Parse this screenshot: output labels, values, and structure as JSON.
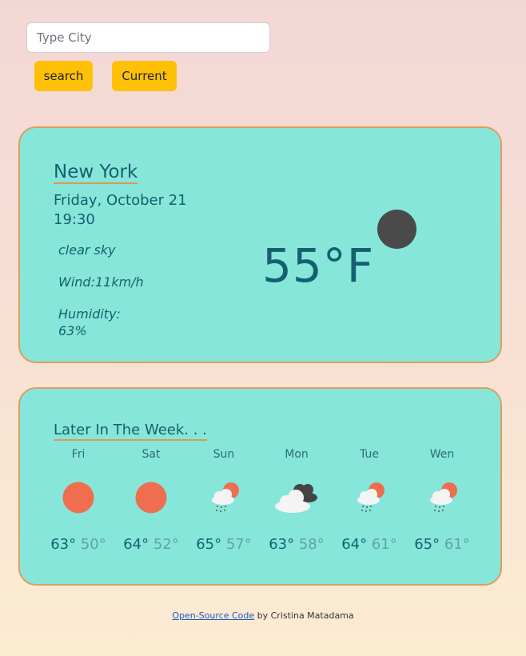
{
  "search": {
    "placeholder": "Type City",
    "value": ""
  },
  "buttons": {
    "search": "search",
    "current": "Current"
  },
  "current": {
    "city": "New York",
    "date": "Friday, October 21",
    "time": "19:30",
    "description": "clear sky",
    "wind": "Wind:11km/h",
    "humidity_label": "Humidity:",
    "humidity_value": "63%",
    "temperature": "55°F",
    "icon": "moon-icon"
  },
  "forecast": {
    "title": "Later In The Week. . .",
    "days": [
      {
        "name": "Fri",
        "high": "63°",
        "low": "50°",
        "icon": "sun-icon"
      },
      {
        "name": "Sat",
        "high": "64°",
        "low": "52°",
        "icon": "sun-icon"
      },
      {
        "name": "Sun",
        "high": "65°",
        "low": "57°",
        "icon": "sun-cloud-rain-icon"
      },
      {
        "name": "Mon",
        "high": "63°",
        "low": "58°",
        "icon": "dark-cloud-icon"
      },
      {
        "name": "Tue",
        "high": "64°",
        "low": "61°",
        "icon": "sun-cloud-rain-icon"
      },
      {
        "name": "Wen",
        "high": "65°",
        "low": "61°",
        "icon": "sun-cloud-rain-icon"
      }
    ]
  },
  "footer": {
    "link": "Open-Source Code",
    "text": " by Cristina Matadama"
  },
  "colors": {
    "card": "#87e6da",
    "border": "#d9a05e",
    "button": "#ffc107",
    "text": "#15606f",
    "sun": "#ee6e4f"
  }
}
